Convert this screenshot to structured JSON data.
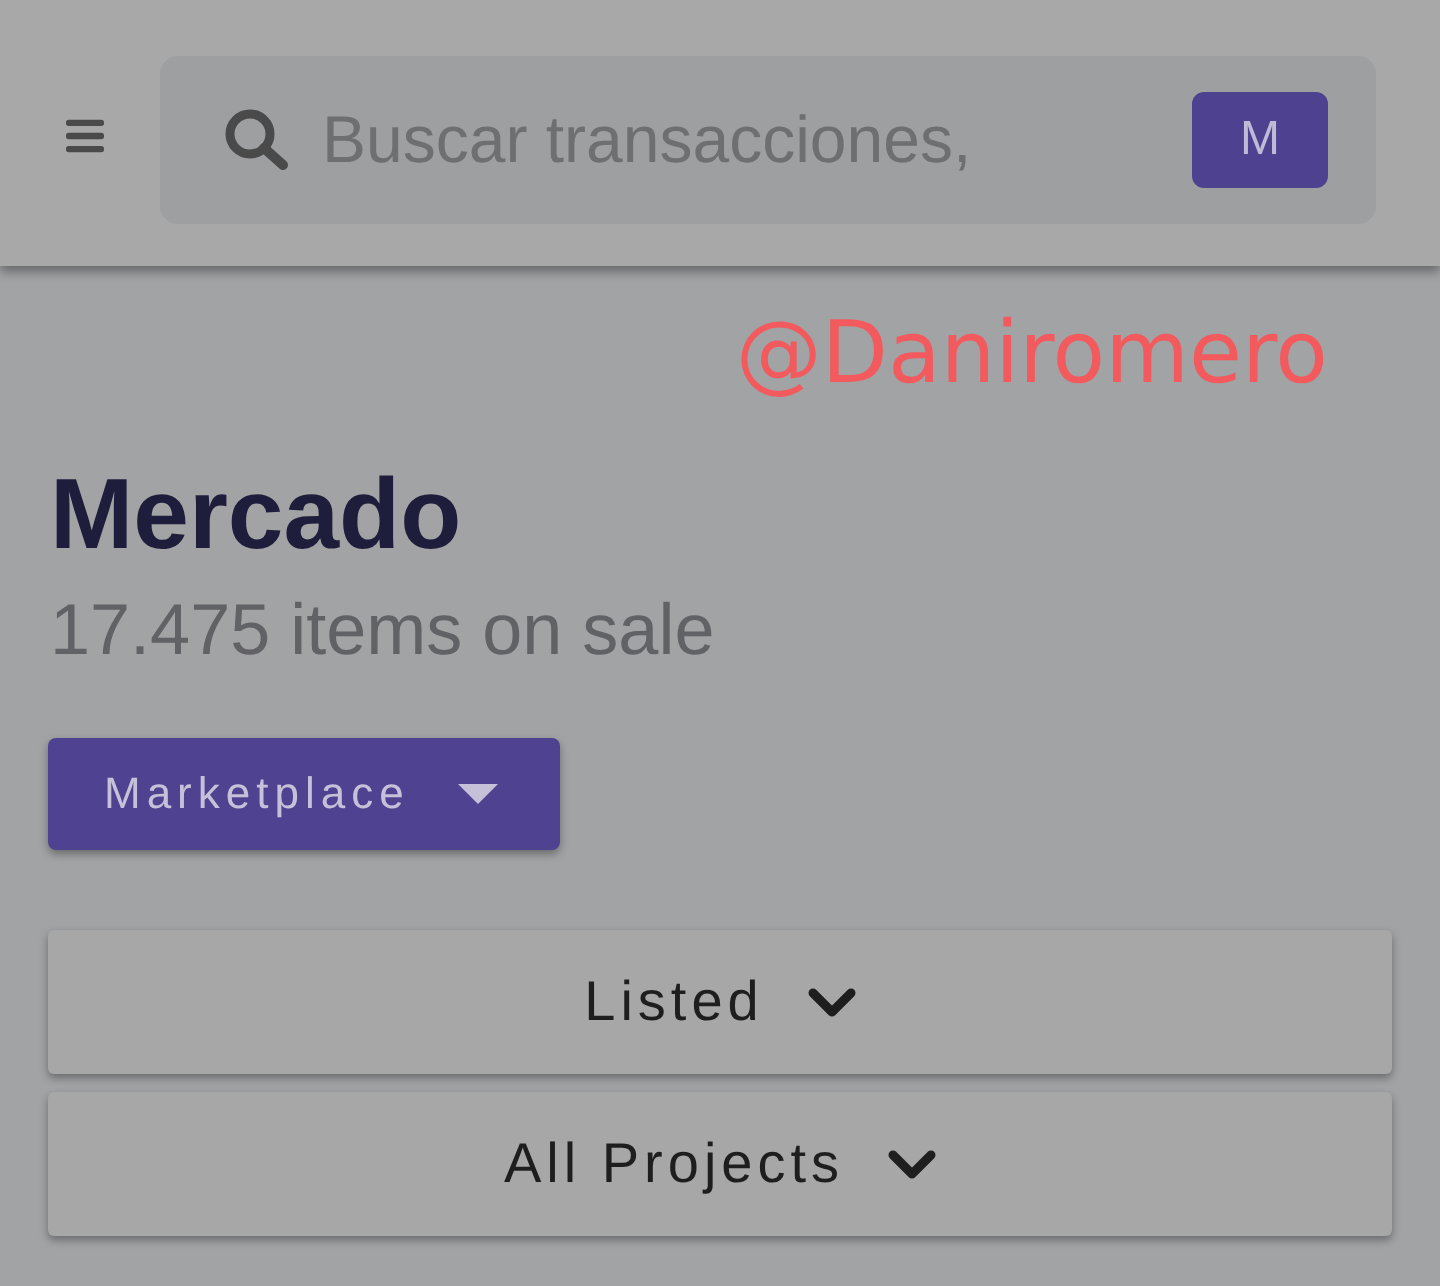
{
  "header": {
    "search": {
      "placeholder": "Buscar transacciones,"
    },
    "avatar": {
      "initial": "M"
    }
  },
  "overlay_text": "@Daniromero",
  "page": {
    "title": "Mercado",
    "subtitle": "17.475 items on sale"
  },
  "category_dropdown": {
    "label": "Marketplace"
  },
  "filters": [
    {
      "label": "Listed"
    },
    {
      "label": "All Projects"
    }
  ]
}
